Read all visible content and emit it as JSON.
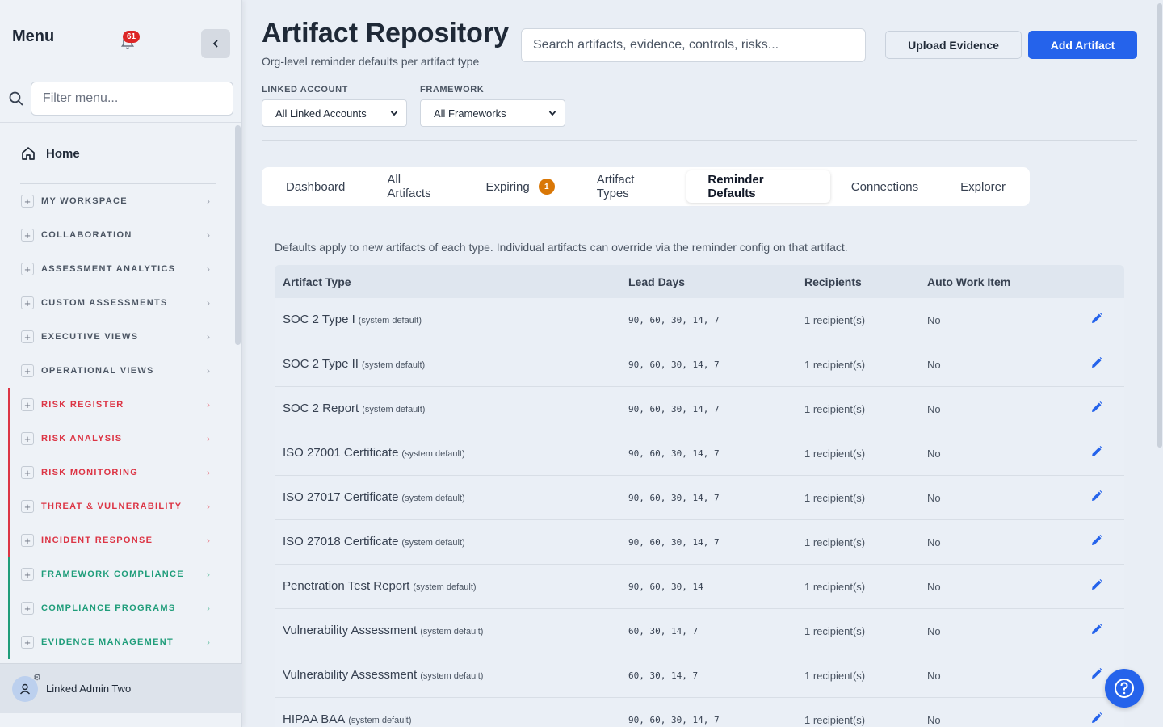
{
  "sidebar": {
    "title": "Menu",
    "notification_count": "61",
    "filter_placeholder": "Filter menu...",
    "home_label": "Home",
    "sections": [
      {
        "label": "MY WORKSPACE",
        "tone": "neutral"
      },
      {
        "label": "COLLABORATION",
        "tone": "neutral"
      },
      {
        "label": "ASSESSMENT ANALYTICS",
        "tone": "neutral"
      },
      {
        "label": "CUSTOM ASSESSMENTS",
        "tone": "neutral"
      },
      {
        "label": "EXECUTIVE VIEWS",
        "tone": "neutral"
      },
      {
        "label": "OPERATIONAL VIEWS",
        "tone": "neutral"
      },
      {
        "label": "RISK REGISTER",
        "tone": "red"
      },
      {
        "label": "RISK ANALYSIS",
        "tone": "red"
      },
      {
        "label": "RISK MONITORING",
        "tone": "red"
      },
      {
        "label": "THREAT & VULNERABILITY",
        "tone": "red"
      },
      {
        "label": "INCIDENT RESPONSE",
        "tone": "red"
      },
      {
        "label": "FRAMEWORK COMPLIANCE",
        "tone": "green"
      },
      {
        "label": "COMPLIANCE PROGRAMS",
        "tone": "green"
      },
      {
        "label": "EVIDENCE MANAGEMENT",
        "tone": "green"
      }
    ],
    "user_name": "Linked Admin Two"
  },
  "header": {
    "title": "Artifact Repository",
    "subtitle": "Org-level reminder defaults per artifact type",
    "search_placeholder": "Search artifacts, evidence, controls, risks...",
    "upload_label": "Upload Evidence",
    "add_label": "Add Artifact"
  },
  "filters": {
    "linked_account_label": "LINKED ACCOUNT",
    "linked_account_value": "All Linked Accounts",
    "framework_label": "FRAMEWORK",
    "framework_value": "All Frameworks"
  },
  "tabs": [
    {
      "label": "Dashboard",
      "badge": null,
      "active": false
    },
    {
      "label": "All Artifacts",
      "badge": null,
      "active": false
    },
    {
      "label": "Expiring",
      "badge": "1",
      "active": false
    },
    {
      "label": "Artifact Types",
      "badge": null,
      "active": false
    },
    {
      "label": "Reminder Defaults",
      "badge": null,
      "active": true
    },
    {
      "label": "Connections",
      "badge": null,
      "active": false
    },
    {
      "label": "Explorer",
      "badge": null,
      "active": false
    }
  ],
  "note": "Defaults apply to new artifacts of each type. Individual artifacts can override via the reminder config on that artifact.",
  "table": {
    "columns": [
      "Artifact Type",
      "Lead Days",
      "Recipients",
      "Auto Work Item"
    ],
    "rows": [
      {
        "type": "SOC 2 Type I",
        "tag": "(system default)",
        "lead_days": "90, 60, 30, 14, 7",
        "recipients": "1 recipient(s)",
        "auto": "No"
      },
      {
        "type": "SOC 2 Type II",
        "tag": "(system default)",
        "lead_days": "90, 60, 30, 14, 7",
        "recipients": "1 recipient(s)",
        "auto": "No"
      },
      {
        "type": "SOC 2 Report",
        "tag": "(system default)",
        "lead_days": "90, 60, 30, 14, 7",
        "recipients": "1 recipient(s)",
        "auto": "No"
      },
      {
        "type": "ISO 27001 Certificate",
        "tag": "(system default)",
        "lead_days": "90, 60, 30, 14, 7",
        "recipients": "1 recipient(s)",
        "auto": "No"
      },
      {
        "type": "ISO 27017 Certificate",
        "tag": "(system default)",
        "lead_days": "90, 60, 30, 14, 7",
        "recipients": "1 recipient(s)",
        "auto": "No"
      },
      {
        "type": "ISO 27018 Certificate",
        "tag": "(system default)",
        "lead_days": "90, 60, 30, 14, 7",
        "recipients": "1 recipient(s)",
        "auto": "No"
      },
      {
        "type": "Penetration Test Report",
        "tag": "(system default)",
        "lead_days": "90, 60, 30, 14",
        "recipients": "1 recipient(s)",
        "auto": "No"
      },
      {
        "type": "Vulnerability Assessment",
        "tag": "(system default)",
        "lead_days": "60, 30, 14, 7",
        "recipients": "1 recipient(s)",
        "auto": "No"
      },
      {
        "type": "Vulnerability Assessment",
        "tag": "(system default)",
        "lead_days": "60, 30, 14, 7",
        "recipients": "1 recipient(s)",
        "auto": "No"
      },
      {
        "type": "HIPAA BAA",
        "tag": "(system default)",
        "lead_days": "90, 60, 30, 14, 7",
        "recipients": "1 recipient(s)",
        "auto": "No"
      }
    ]
  },
  "colors": {
    "primary": "#2563eb",
    "danger_section": "#dc3545",
    "compliance_section": "#1f9d7a",
    "badge_warning": "#d97706"
  }
}
